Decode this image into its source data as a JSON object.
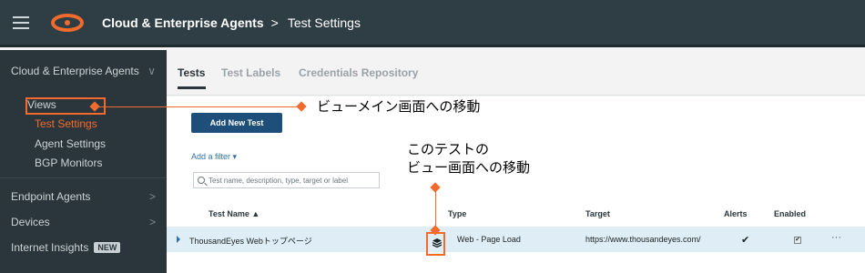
{
  "header": {
    "section": "Cloud & Enterprise Agents",
    "separator": ">",
    "page": "Test Settings"
  },
  "sidebar": {
    "section_title": "Cloud & Enterprise Agents",
    "section_chevron": "∨",
    "items": [
      "Views",
      "Test Settings",
      "Agent Settings",
      "BGP Monitors"
    ],
    "other_sections": [
      {
        "label": "Endpoint Agents",
        "chevron": ">"
      },
      {
        "label": "Devices",
        "chevron": ">"
      },
      {
        "label": "Internet Insights",
        "badge": "NEW"
      }
    ]
  },
  "tabs": [
    "Tests",
    "Test Labels",
    "Credentials Repository"
  ],
  "toolbar": {
    "add_button": "Add New Test",
    "add_filter": "Add a filter ▾",
    "search_placeholder": "Test name, description, type, target or label"
  },
  "table": {
    "headers": {
      "name": "Test Name ▲",
      "type": "Type",
      "target": "Target",
      "alerts": "Alerts",
      "enabled": "Enabled"
    },
    "rows": [
      {
        "name": "ThousandEyes Webトップページ",
        "type": "Web - Page Load",
        "target": "https://www.thousandeyes.com/",
        "alerts": "✔",
        "enabled": "✔",
        "more": "···"
      }
    ]
  },
  "annotations": {
    "views_nav": "ビューメイン画面への移動",
    "test_view_line1": "このテストの",
    "test_view_line2": "ビュー画面への移動"
  },
  "colors": {
    "accent": "#f26b2c",
    "topbar": "#2f3d44",
    "sidebar": "#2b363c",
    "button": "#1d4f7a"
  }
}
